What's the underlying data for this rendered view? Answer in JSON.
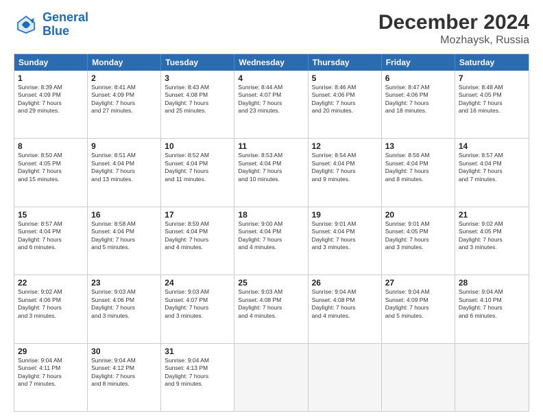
{
  "logo": {
    "line1": "General",
    "line2": "Blue"
  },
  "title": "December 2024",
  "subtitle": "Mozhaysk, Russia",
  "weekdays": [
    "Sunday",
    "Monday",
    "Tuesday",
    "Wednesday",
    "Thursday",
    "Friday",
    "Saturday"
  ],
  "weeks": [
    [
      {
        "day": "1",
        "info": "Sunrise: 8:39 AM\nSunset: 4:09 PM\nDaylight: 7 hours\nand 29 minutes."
      },
      {
        "day": "2",
        "info": "Sunrise: 8:41 AM\nSunset: 4:09 PM\nDaylight: 7 hours\nand 27 minutes."
      },
      {
        "day": "3",
        "info": "Sunrise: 8:43 AM\nSunset: 4:08 PM\nDaylight: 7 hours\nand 25 minutes."
      },
      {
        "day": "4",
        "info": "Sunrise: 8:44 AM\nSunset: 4:07 PM\nDaylight: 7 hours\nand 23 minutes."
      },
      {
        "day": "5",
        "info": "Sunrise: 8:46 AM\nSunset: 4:06 PM\nDaylight: 7 hours\nand 20 minutes."
      },
      {
        "day": "6",
        "info": "Sunrise: 8:47 AM\nSunset: 4:06 PM\nDaylight: 7 hours\nand 18 minutes."
      },
      {
        "day": "7",
        "info": "Sunrise: 8:48 AM\nSunset: 4:05 PM\nDaylight: 7 hours\nand 16 minutes."
      }
    ],
    [
      {
        "day": "8",
        "info": "Sunrise: 8:50 AM\nSunset: 4:05 PM\nDaylight: 7 hours\nand 15 minutes."
      },
      {
        "day": "9",
        "info": "Sunrise: 8:51 AM\nSunset: 4:04 PM\nDaylight: 7 hours\nand 13 minutes."
      },
      {
        "day": "10",
        "info": "Sunrise: 8:52 AM\nSunset: 4:04 PM\nDaylight: 7 hours\nand 11 minutes."
      },
      {
        "day": "11",
        "info": "Sunrise: 8:53 AM\nSunset: 4:04 PM\nDaylight: 7 hours\nand 10 minutes."
      },
      {
        "day": "12",
        "info": "Sunrise: 8:54 AM\nSunset: 4:04 PM\nDaylight: 7 hours\nand 9 minutes."
      },
      {
        "day": "13",
        "info": "Sunrise: 8:56 AM\nSunset: 4:04 PM\nDaylight: 7 hours\nand 8 minutes."
      },
      {
        "day": "14",
        "info": "Sunrise: 8:57 AM\nSunset: 4:04 PM\nDaylight: 7 hours\nand 7 minutes."
      }
    ],
    [
      {
        "day": "15",
        "info": "Sunrise: 8:57 AM\nSunset: 4:04 PM\nDaylight: 7 hours\nand 6 minutes."
      },
      {
        "day": "16",
        "info": "Sunrise: 8:58 AM\nSunset: 4:04 PM\nDaylight: 7 hours\nand 5 minutes."
      },
      {
        "day": "17",
        "info": "Sunrise: 8:59 AM\nSunset: 4:04 PM\nDaylight: 7 hours\nand 4 minutes."
      },
      {
        "day": "18",
        "info": "Sunrise: 9:00 AM\nSunset: 4:04 PM\nDaylight: 7 hours\nand 4 minutes."
      },
      {
        "day": "19",
        "info": "Sunrise: 9:01 AM\nSunset: 4:04 PM\nDaylight: 7 hours\nand 3 minutes."
      },
      {
        "day": "20",
        "info": "Sunrise: 9:01 AM\nSunset: 4:05 PM\nDaylight: 7 hours\nand 3 minutes."
      },
      {
        "day": "21",
        "info": "Sunrise: 9:02 AM\nSunset: 4:05 PM\nDaylight: 7 hours\nand 3 minutes."
      }
    ],
    [
      {
        "day": "22",
        "info": "Sunrise: 9:02 AM\nSunset: 4:06 PM\nDaylight: 7 hours\nand 3 minutes."
      },
      {
        "day": "23",
        "info": "Sunrise: 9:03 AM\nSunset: 4:06 PM\nDaylight: 7 hours\nand 3 minutes."
      },
      {
        "day": "24",
        "info": "Sunrise: 9:03 AM\nSunset: 4:07 PM\nDaylight: 7 hours\nand 3 minutes."
      },
      {
        "day": "25",
        "info": "Sunrise: 9:03 AM\nSunset: 4:08 PM\nDaylight: 7 hours\nand 4 minutes."
      },
      {
        "day": "26",
        "info": "Sunrise: 9:04 AM\nSunset: 4:08 PM\nDaylight: 7 hours\nand 4 minutes."
      },
      {
        "day": "27",
        "info": "Sunrise: 9:04 AM\nSunset: 4:09 PM\nDaylight: 7 hours\nand 5 minutes."
      },
      {
        "day": "28",
        "info": "Sunrise: 9:04 AM\nSunset: 4:10 PM\nDaylight: 7 hours\nand 6 minutes."
      }
    ],
    [
      {
        "day": "29",
        "info": "Sunrise: 9:04 AM\nSunset: 4:11 PM\nDaylight: 7 hours\nand 7 minutes."
      },
      {
        "day": "30",
        "info": "Sunrise: 9:04 AM\nSunset: 4:12 PM\nDaylight: 7 hours\nand 8 minutes."
      },
      {
        "day": "31",
        "info": "Sunrise: 9:04 AM\nSunset: 4:13 PM\nDaylight: 7 hours\nand 9 minutes."
      },
      null,
      null,
      null,
      null
    ]
  ]
}
